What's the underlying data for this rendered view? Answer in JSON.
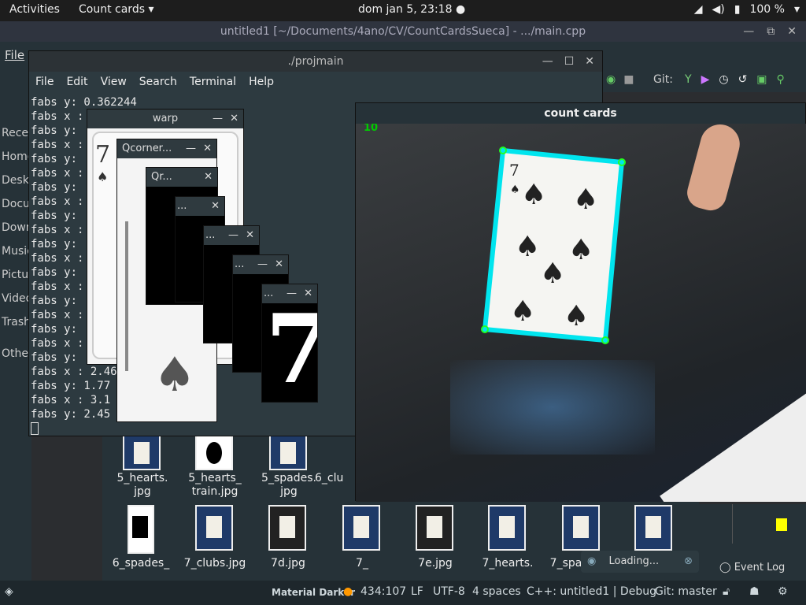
{
  "topbar": {
    "activities": "Activities",
    "app_menu": "Count cards",
    "clock": "dom jan  5, 23:18",
    "battery": "100 %"
  },
  "ide": {
    "title": "untitled1 [~/Documents/4ano/CV/CountCardsSueca] - .../main.cpp",
    "menu_file": "File",
    "git_label": "Git:",
    "sidebar": [
      "Recen",
      "Home",
      "Deskt",
      "Docu",
      "Down",
      "Music",
      "Pictu",
      "Video",
      "Trash",
      "Other"
    ]
  },
  "terminal": {
    "title": "./projmain",
    "menu": [
      "File",
      "Edit",
      "View",
      "Search",
      "Terminal",
      "Help"
    ],
    "lines": [
      "fabs y: 0.362244",
      "fabs x :",
      "fabs y:",
      "fabs x :",
      "fabs y:",
      "fabs x :",
      "fabs y:",
      "fabs x :",
      "fabs y:",
      "fabs x :",
      "fabs y:",
      "fabs x :",
      "fabs y:",
      "fabs x :",
      "fabs y:",
      "fabs x :",
      "fabs y:",
      "fabs x :",
      "fabs y:",
      "fabs x : 2.46",
      "fabs y: 1.77",
      "fabs x : 3.1",
      "fabs y: 2.45"
    ]
  },
  "cv_windows": {
    "warp": "warp",
    "qcorner": "Qcorner...",
    "qr": "Qr...",
    "w1": "...",
    "w2": "...",
    "w3": "...",
    "w4": "..."
  },
  "count_cards": {
    "title": "count cards",
    "count_overlay": "10",
    "card_rank": "7"
  },
  "files": [
    {
      "name": "5_hearts.\njpg"
    },
    {
      "name": "5_hearts_\ntrain.jpg"
    },
    {
      "name": "5_spades.\njpg"
    },
    {
      "name": "6_clu"
    },
    {
      "name": "6_spades_"
    },
    {
      "name": "7_clubs.jpg"
    },
    {
      "name": "7d.jpg"
    },
    {
      "name": "7_"
    },
    {
      "name": "7e.jpg"
    },
    {
      "name": "7_hearts."
    },
    {
      "name": "7_spa"
    }
  ],
  "loading": "Loading...",
  "event_log": "Event Log",
  "statusbar": {
    "theme": "Material Darker",
    "position": "434:107",
    "line_ending": "LF",
    "encoding": "UTF-8",
    "indent": "4 spaces",
    "context": "C++: untitled1 | Debug",
    "git": "Git: master"
  }
}
